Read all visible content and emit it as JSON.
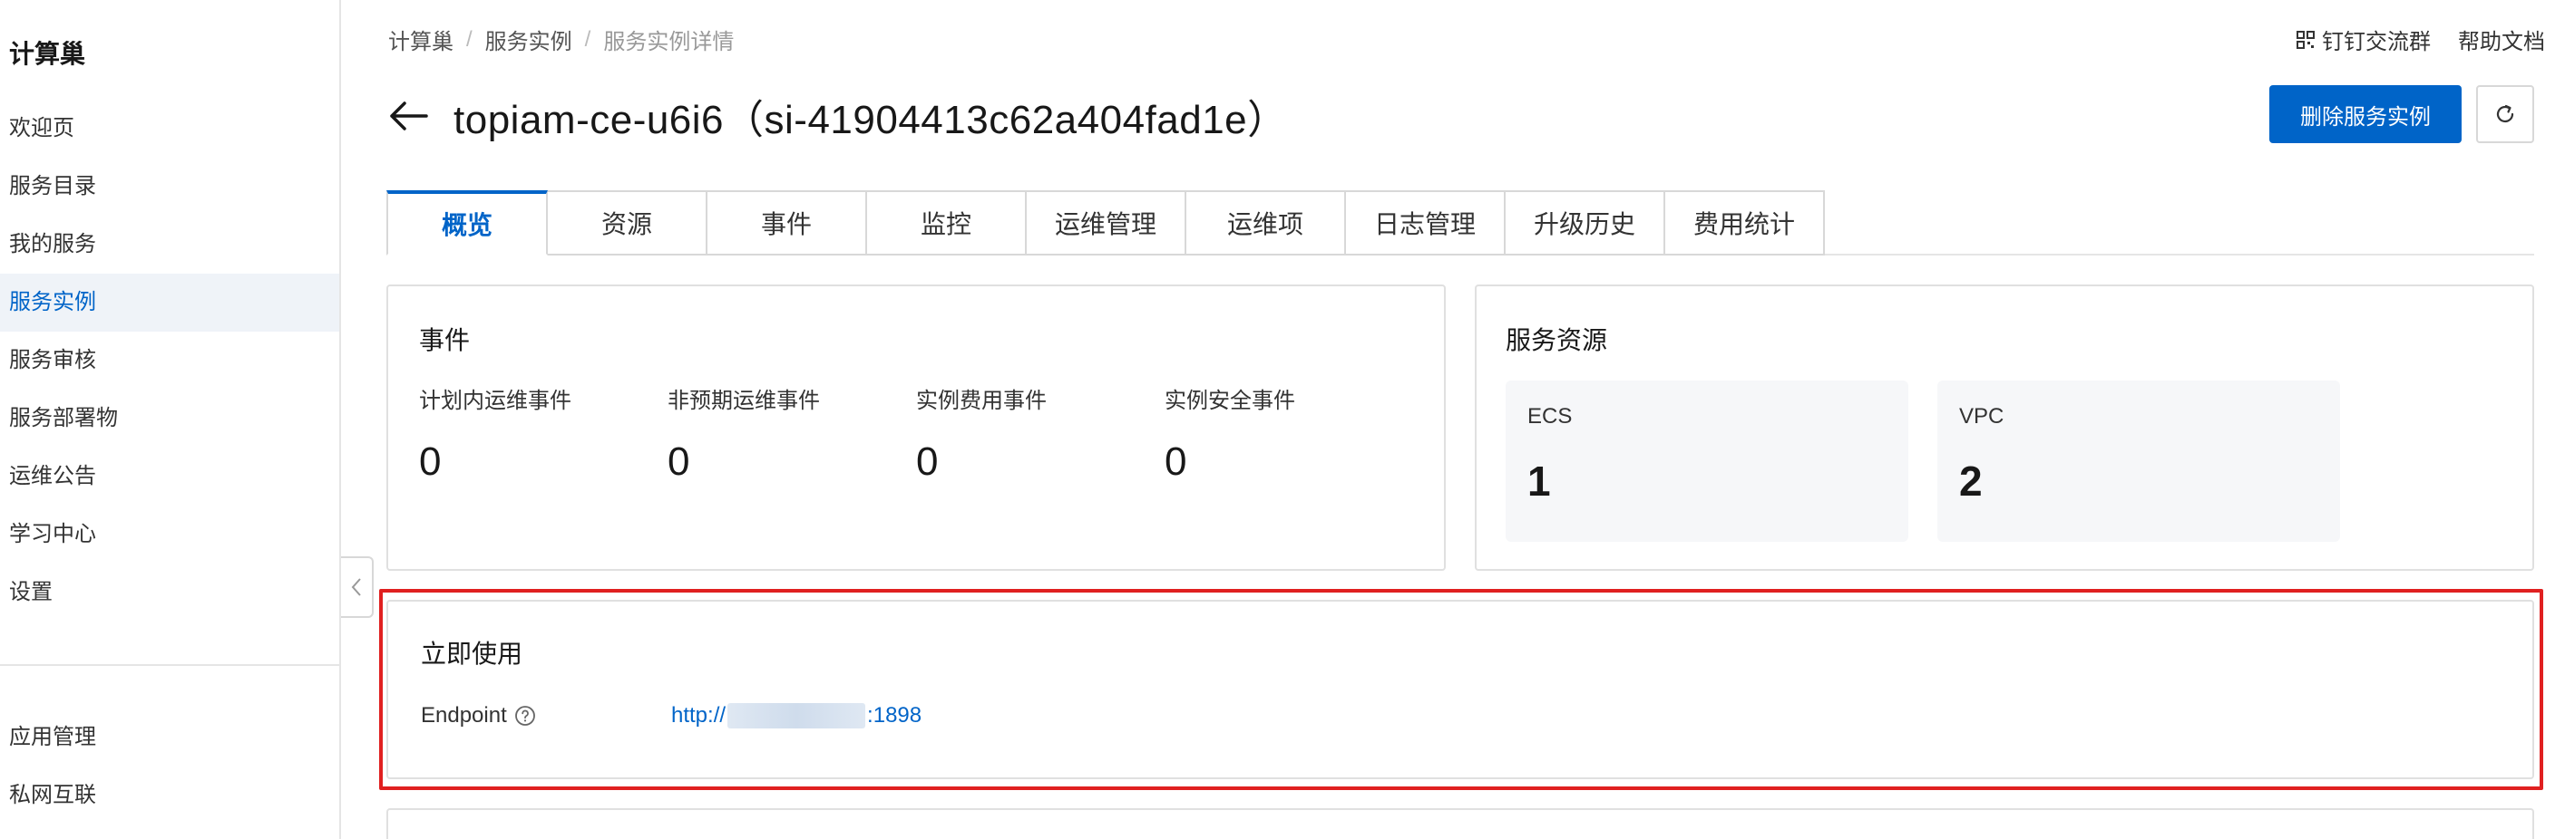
{
  "sidebar": {
    "brand": "计算巢",
    "items": [
      {
        "label": "欢迎页"
      },
      {
        "label": "服务目录"
      },
      {
        "label": "我的服务"
      },
      {
        "label": "服务实例"
      },
      {
        "label": "服务审核"
      },
      {
        "label": "服务部署物"
      },
      {
        "label": "运维公告"
      },
      {
        "label": "学习中心"
      },
      {
        "label": "设置"
      }
    ],
    "bottom_items": [
      {
        "label": "应用管理"
      },
      {
        "label": "私网互联"
      }
    ],
    "active_item": "服务实例"
  },
  "breadcrumb": {
    "items": [
      "计算巢",
      "服务实例",
      "服务实例详情"
    ],
    "separator": "/"
  },
  "top_links": {
    "dingtalk": "钉钉交流群",
    "help": "帮助文档"
  },
  "page": {
    "title": "topiam-ce-u6i6（si-41904413c62a404fad1e）"
  },
  "actions": {
    "delete_label": "删除服务实例"
  },
  "tabs": [
    {
      "label": "概览",
      "active": true
    },
    {
      "label": "资源"
    },
    {
      "label": "事件"
    },
    {
      "label": "监控"
    },
    {
      "label": "运维管理"
    },
    {
      "label": "运维项"
    },
    {
      "label": "日志管理"
    },
    {
      "label": "升级历史"
    },
    {
      "label": "费用统计"
    }
  ],
  "events": {
    "title": "事件",
    "items": [
      {
        "label": "计划内运维事件",
        "value": "0"
      },
      {
        "label": "非预期运维事件",
        "value": "0"
      },
      {
        "label": "实例费用事件",
        "value": "0"
      },
      {
        "label": "实例安全事件",
        "value": "0"
      }
    ]
  },
  "resources": {
    "title": "服务资源",
    "items": [
      {
        "label": "ECS",
        "value": "1"
      },
      {
        "label": "VPC",
        "value": "2"
      }
    ]
  },
  "use_now": {
    "title": "立即使用",
    "endpoint_label": "Endpoint",
    "endpoint_prefix": "http://",
    "endpoint_suffix": ":1898"
  },
  "colors": {
    "primary": "#0064c8",
    "highlight": "#e02020",
    "active_bg": "#eff3f8"
  }
}
